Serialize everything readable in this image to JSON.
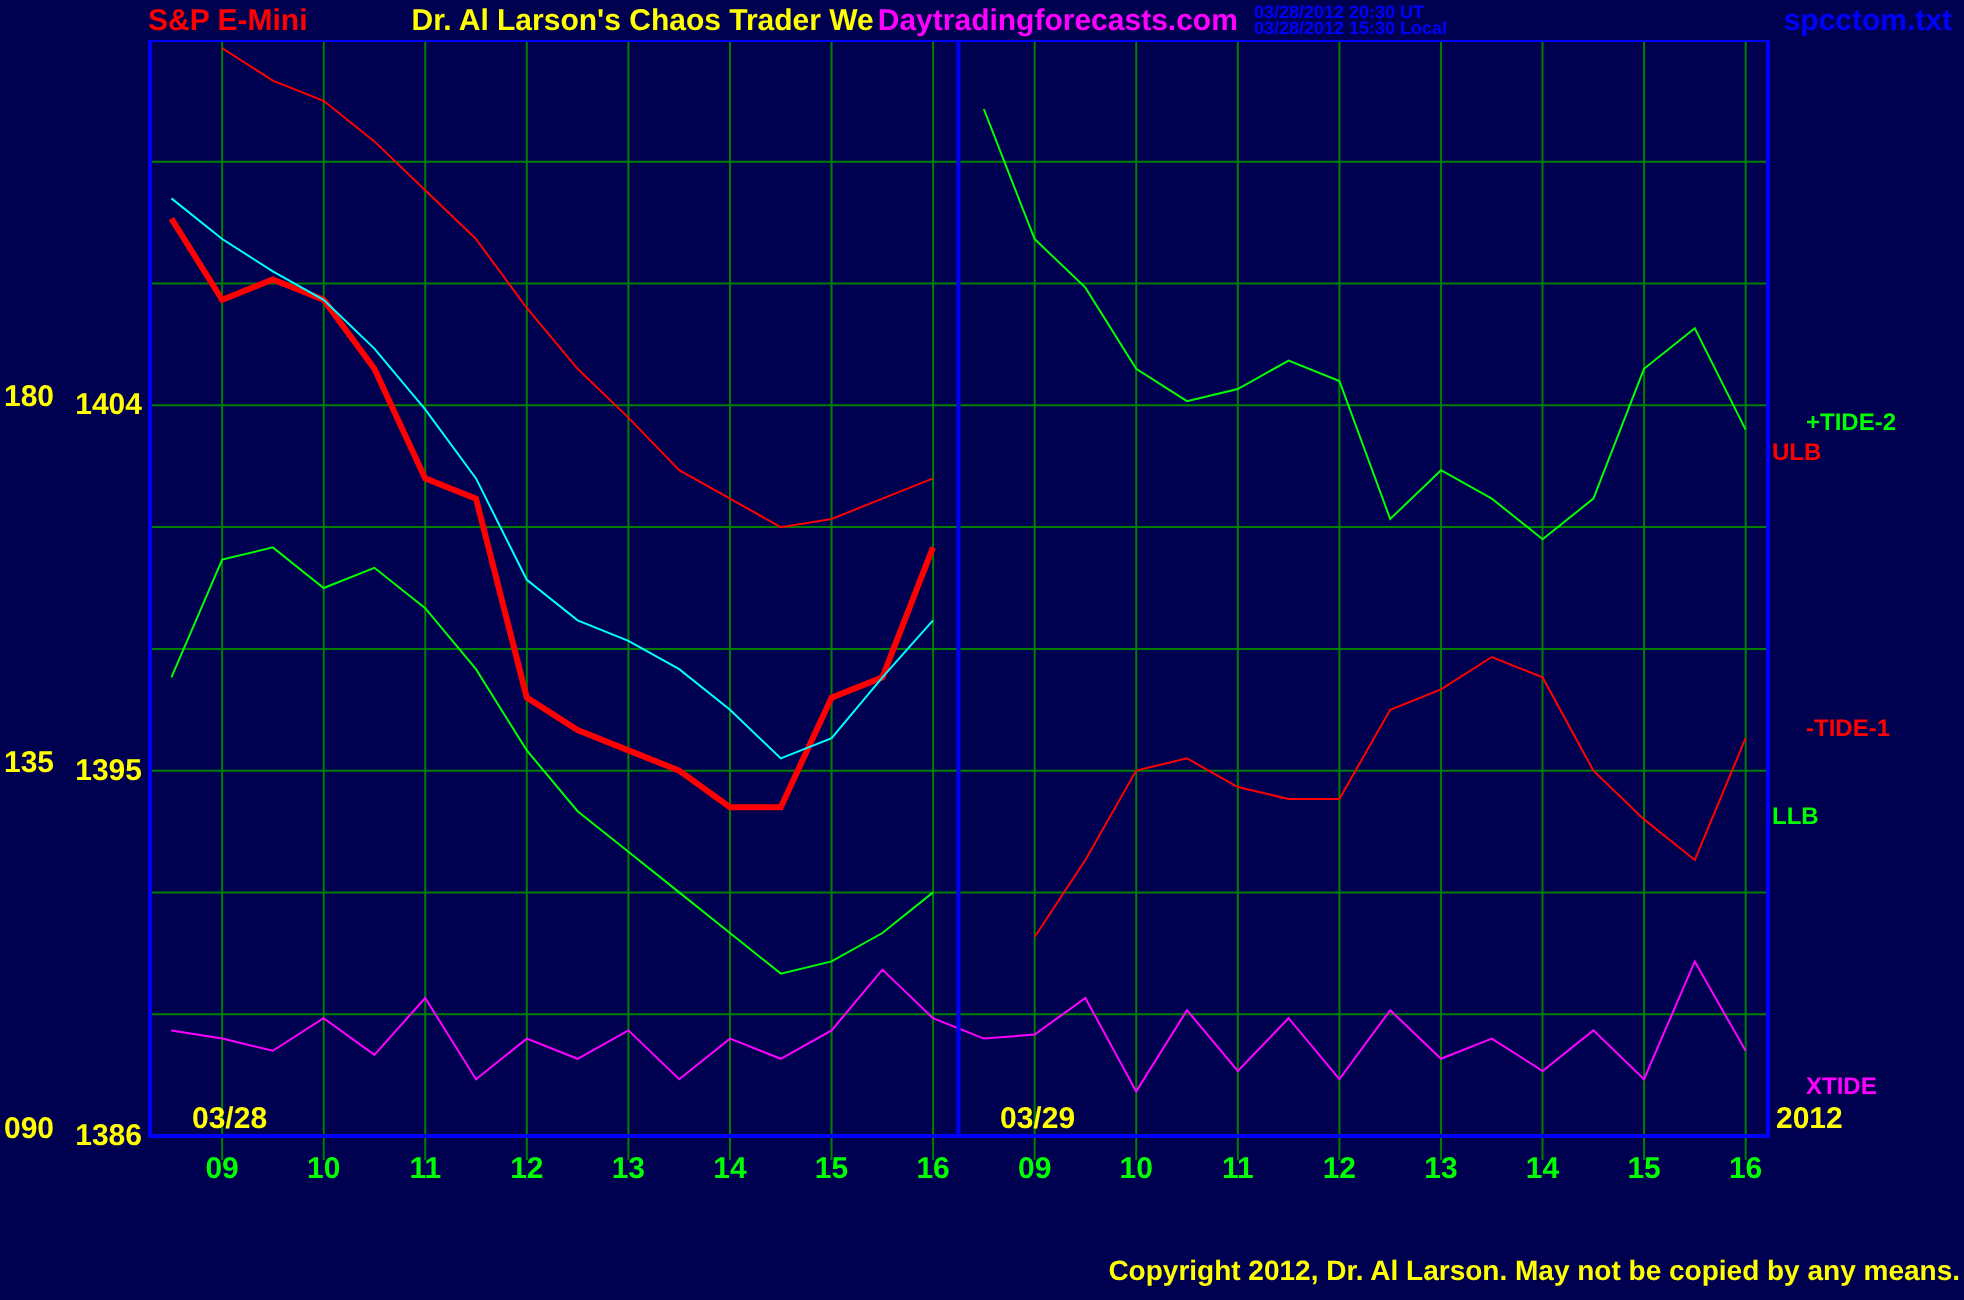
{
  "header": {
    "symbol": "S&P E-Mini",
    "title": "Dr. Al Larson's Chaos Trader We",
    "site": "Daytradingforecasts.com",
    "timestamps": [
      "03/28/2012 20:30 UT",
      "03/28/2012 15:30 Local"
    ],
    "file": "spcctom.txt"
  },
  "chart": {
    "scale_labels": [
      "180",
      "135",
      "090"
    ],
    "date_labels": [
      "03/28",
      "03/29",
      "2012"
    ],
    "chart_data": {
      "type": "line",
      "grid": true,
      "categories": [
        null,
        "09",
        null,
        "10",
        null,
        "11",
        null,
        "12",
        null,
        "13",
        null,
        "14",
        null,
        "15",
        null,
        "16",
        null,
        "09",
        null,
        "10",
        null,
        "11",
        null,
        "12",
        null,
        "13",
        null,
        "14",
        null,
        "15",
        null,
        "16"
      ],
      "ylim": [
        1386,
        1413
      ],
      "yticks": [
        {
          "value": 1404,
          "label": "1404"
        },
        {
          "value": 1395,
          "label": "1395"
        },
        {
          "value": 1386,
          "label": "1386"
        }
      ],
      "series": [
        {
          "color": "#ff0000",
          "values": [
            1408.6,
            1406.6,
            1407.1,
            1406.6,
            1404.9,
            1402.2,
            1401.7,
            1396.8,
            1396.0,
            1395.5,
            1395.0,
            1394.1,
            1394.1,
            1396.8,
            1397.3,
            1400.5,
            null,
            null,
            null,
            null,
            null,
            null,
            null,
            null,
            null,
            null,
            null,
            null,
            null,
            null,
            null,
            null
          ]
        },
        {
          "color": "#00ffff",
          "values": [
            1409.1,
            1408.1,
            1407.3,
            1406.6,
            1405.4,
            1403.9,
            1402.2,
            1399.7,
            1398.7,
            1398.2,
            1397.5,
            1396.5,
            1395.3,
            1395.8,
            1397.3,
            1398.7,
            null,
            null,
            null,
            null,
            null,
            null,
            null,
            null,
            null,
            null,
            null,
            null,
            null,
            null,
            null,
            null
          ]
        },
        {
          "name": "ULB",
          "color": "#ff0000",
          "values": [
            null,
            1412.8,
            1412.0,
            1411.5,
            1410.5,
            1409.3,
            1408.1,
            1406.4,
            1404.9,
            1403.7,
            1402.4,
            1401.7,
            1401.0,
            1401.2,
            1401.7,
            1402.2,
            null,
            null,
            null,
            null,
            null,
            null,
            null,
            null,
            null,
            null,
            null,
            null,
            null,
            null,
            null,
            null
          ]
        },
        {
          "name": "LLB",
          "color": "#00ff00",
          "values": [
            1397.3,
            1400.2,
            1400.5,
            1399.5,
            1400.0,
            1399.0,
            1397.5,
            1395.5,
            1394.0,
            1393.0,
            1392.0,
            1391.0,
            1390.0,
            1390.3,
            1391.0,
            1392.0,
            null,
            null,
            null,
            null,
            null,
            null,
            null,
            null,
            null,
            null,
            null,
            null,
            null,
            null,
            null,
            null
          ]
        },
        {
          "name": "+TIDE-2",
          "color": "#00ff00",
          "values": [
            null,
            null,
            null,
            null,
            null,
            null,
            null,
            null,
            null,
            null,
            null,
            null,
            null,
            null,
            null,
            null,
            1411.3,
            1408.1,
            1406.9,
            1404.9,
            1404.1,
            1404.4,
            1405.1,
            1404.6,
            1401.2,
            1402.4,
            1401.7,
            1400.7,
            1401.7,
            1404.9,
            1405.9,
            1403.4
          ]
        },
        {
          "name": "-TIDE-1",
          "color": "#ff0000",
          "values": [
            null,
            null,
            null,
            null,
            null,
            null,
            null,
            null,
            null,
            null,
            null,
            null,
            null,
            null,
            null,
            null,
            null,
            1390.9,
            1392.8,
            1395.0,
            1395.3,
            1394.6,
            1394.3,
            1394.3,
            1396.5,
            1397.0,
            1397.8,
            1397.3,
            1395.0,
            1393.8,
            1392.8,
            1395.8
          ]
        },
        {
          "name": "XTIDE",
          "color": "#ff00ff",
          "values": [
            1388.6,
            1388.4,
            1388.1,
            1388.9,
            1388.0,
            1389.4,
            1387.4,
            1388.4,
            1387.9,
            1388.6,
            1387.4,
            1388.4,
            1387.9,
            1388.6,
            1390.1,
            1388.9,
            1388.4,
            1388.5,
            1389.4,
            1387.1,
            1389.1,
            1387.6,
            1388.9,
            1387.4,
            1389.1,
            1387.9,
            1388.4,
            1387.6,
            1388.6,
            1387.4,
            1390.3,
            1388.1
          ]
        }
      ]
    }
  },
  "footer": {
    "copyright": "Copyright 2012, Dr. Al Larson. May not be copied by any means."
  }
}
